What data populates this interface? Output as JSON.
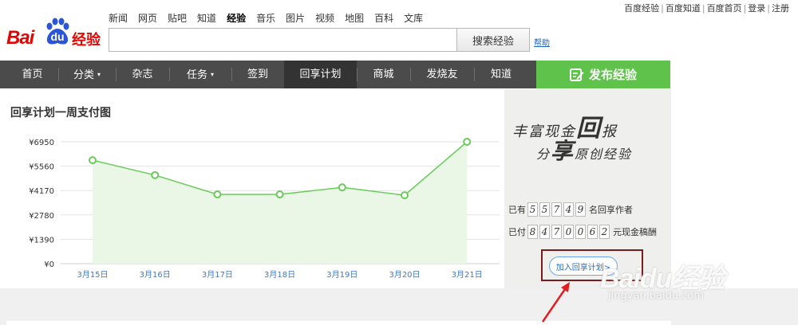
{
  "top_links": [
    "百度经验",
    "百度知道",
    "百度首页",
    "登录",
    "注册"
  ],
  "logo": {
    "bai": "Bai",
    "du": "du",
    "jy": "经验"
  },
  "small_nav": [
    {
      "label": "新闻",
      "active": false
    },
    {
      "label": "网页",
      "active": false
    },
    {
      "label": "贴吧",
      "active": false
    },
    {
      "label": "知道",
      "active": false
    },
    {
      "label": "经验",
      "active": true
    },
    {
      "label": "音乐",
      "active": false
    },
    {
      "label": "图片",
      "active": false
    },
    {
      "label": "视频",
      "active": false
    },
    {
      "label": "地图",
      "active": false
    },
    {
      "label": "百科",
      "active": false
    },
    {
      "label": "文库",
      "active": false
    }
  ],
  "search": {
    "value": "",
    "button_label": "搜索经验",
    "help_label": "帮助"
  },
  "main_nav": [
    {
      "label": "首页",
      "dropdown": false,
      "active": false
    },
    {
      "label": "分类",
      "dropdown": true,
      "active": false
    },
    {
      "label": "杂志",
      "dropdown": false,
      "active": false
    },
    {
      "label": "任务",
      "dropdown": true,
      "active": false
    },
    {
      "label": "签到",
      "dropdown": false,
      "active": false
    },
    {
      "label": "回享计划",
      "dropdown": false,
      "active": true
    },
    {
      "label": "商城",
      "dropdown": false,
      "active": false
    },
    {
      "label": "发烧友",
      "dropdown": false,
      "active": false
    },
    {
      "label": "知道",
      "dropdown": false,
      "active": false
    }
  ],
  "publish_label": "发布经验",
  "chart_data": {
    "type": "area",
    "title": "回享计划一周支付图",
    "categories": [
      "3月15日",
      "3月16日",
      "3月17日",
      "3月18日",
      "3月19日",
      "3月20日",
      "3月21日"
    ],
    "values": [
      5900,
      5050,
      3950,
      3950,
      4350,
      3900,
      6950
    ],
    "y_ticks": [
      "¥0",
      "¥1390",
      "¥2780",
      "¥4170",
      "¥5560",
      "¥6950"
    ],
    "ylim": [
      0,
      6950
    ],
    "grid": true,
    "colors": {
      "line": "#6acb5b",
      "fill": "#eaf6e6",
      "point_fill": "#ffffff",
      "axis_text": "#333333",
      "x_text": "#3e78c9"
    }
  },
  "right_panel": {
    "slogan_line1": {
      "pre": "丰富现金",
      "big": "回",
      "post": "报"
    },
    "slogan_line2": {
      "pre": "分",
      "big": "享",
      "post": "原创经验"
    },
    "authors": {
      "prefix": "已有",
      "digits": [
        "5",
        "5",
        "7",
        "4",
        "9"
      ],
      "suffix": "名回享作者"
    },
    "paid": {
      "prefix": "已付",
      "digits": [
        "8",
        "4",
        "7",
        "0",
        "0",
        "6",
        "2"
      ],
      "suffix": "元现金稿酬"
    },
    "join_label": "加入回享计划>"
  },
  "watermark": {
    "logo": "Baidu经验",
    "url": "jingyan.baidu.com"
  }
}
